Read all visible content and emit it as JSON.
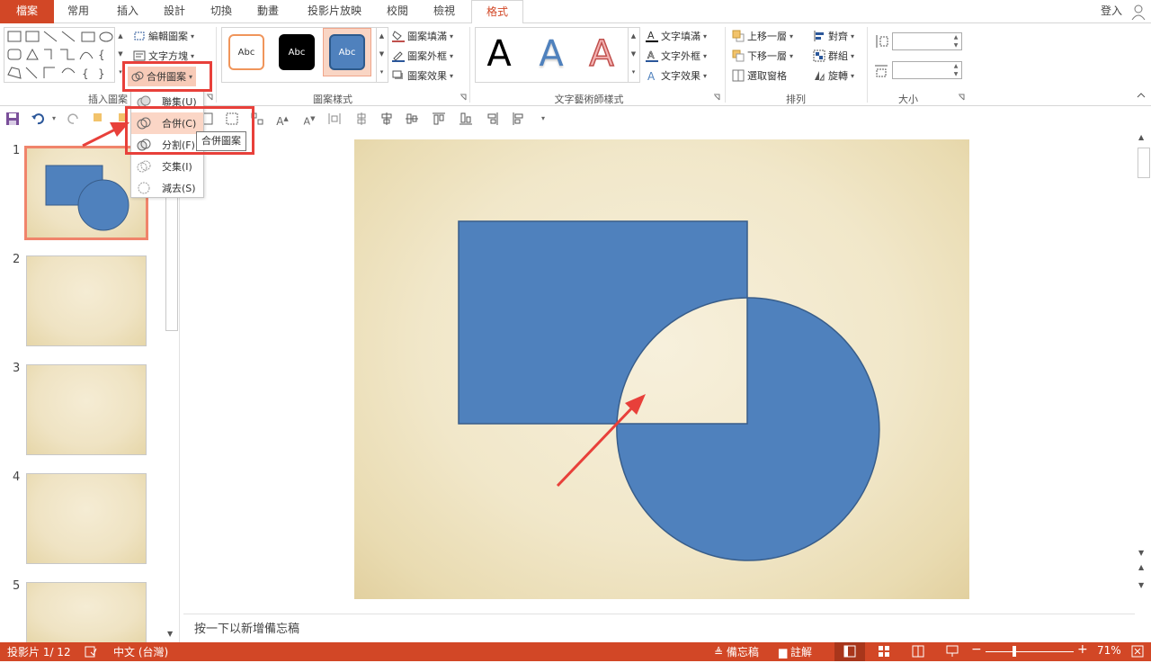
{
  "tabs": {
    "file": "檔案",
    "home": "常用",
    "insert": "插入",
    "design": "設計",
    "transitions": "切換",
    "animations": "動畫",
    "slideshow": "投影片放映",
    "review": "校閱",
    "view": "檢視",
    "format": "格式",
    "signin": "登入"
  },
  "ribbon": {
    "insert_shapes": {
      "label": "插入圖案",
      "edit_shape": "編輯圖案",
      "text_box": "文字方塊",
      "merge_shapes": "合併圖案"
    },
    "shape_styles": {
      "label": "圖案樣式",
      "presets": [
        "Abc",
        "Abc",
        "Abc"
      ],
      "fill": "圖案填滿",
      "outline": "圖案外框",
      "effects": "圖案效果"
    },
    "wordart": {
      "label": "文字藝術師樣式",
      "presets": [
        "A",
        "A",
        "A"
      ],
      "text_fill": "文字填滿",
      "text_outline": "文字外框",
      "text_effects": "文字效果"
    },
    "arrange": {
      "label": "排列",
      "bring_forward": "上移一層",
      "send_backward": "下移一層",
      "selection_pane": "選取窗格",
      "align": "對齊",
      "group": "群組",
      "rotate": "旋轉"
    },
    "size": {
      "label": "大小",
      "height_value": "",
      "width_value": ""
    }
  },
  "merge_menu": {
    "items": [
      {
        "label": "聯集(U)"
      },
      {
        "label": "合併(C)"
      },
      {
        "label": "分割(F)"
      },
      {
        "label": "交集(I)"
      },
      {
        "label": "減去(S)"
      }
    ],
    "tooltip": "合併圖案"
  },
  "thumbnails": [
    "1",
    "2",
    "3",
    "4",
    "5"
  ],
  "notes_placeholder": "按一下以新增備忘稿",
  "status": {
    "slide_info": "投影片 1/ 12",
    "language": "中文 (台灣)",
    "notes": "備忘稿",
    "comments": "註解",
    "zoom": "71%"
  },
  "colors": {
    "accent": "#d24726",
    "shape_fill": "#4f81bd",
    "shape_stroke": "#385d8a",
    "annotation": "#e8403a"
  }
}
